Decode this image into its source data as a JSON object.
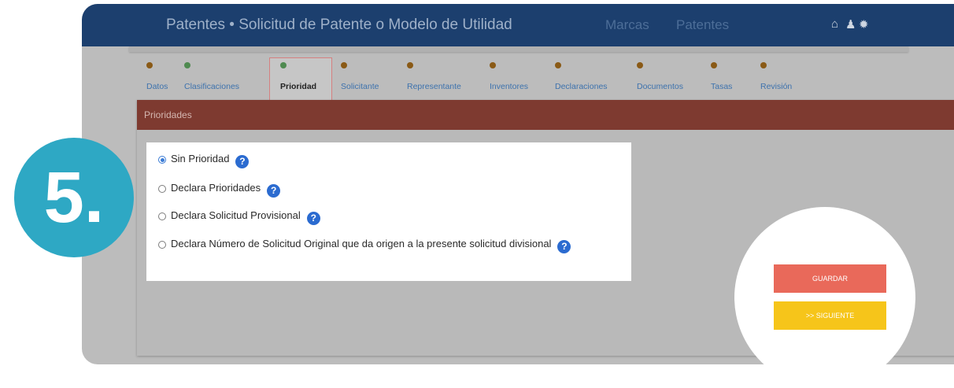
{
  "header": {
    "title": "Patentes • Solicitud de Patente o Modelo de Utilidad",
    "nav": [
      "Marcas",
      "Patentes"
    ],
    "icons": [
      "home-icon",
      "user-icon",
      "settings-icon"
    ]
  },
  "steps": [
    {
      "label": "Datos",
      "status": "warning"
    },
    {
      "label": "Clasificaciones",
      "status": "done"
    },
    {
      "label": "Prioridad",
      "status": "done",
      "active": true
    },
    {
      "label": "Solicitante",
      "status": "warning"
    },
    {
      "label": "Representante",
      "status": "warning"
    },
    {
      "label": "Inventores",
      "status": "warning"
    },
    {
      "label": "Declaraciones",
      "status": "warning"
    },
    {
      "label": "Documentos",
      "status": "warning"
    },
    {
      "label": "Tasas",
      "status": "warning"
    },
    {
      "label": "Revisión",
      "status": "warning"
    }
  ],
  "card": {
    "title": "Prioridades"
  },
  "priority_options": [
    {
      "label": "Sin Prioridad",
      "selected": true
    },
    {
      "label": "Declara Prioridades",
      "selected": false
    },
    {
      "label": "Declara Solicitud Provisional",
      "selected": false
    },
    {
      "label": "Declara Número de Solicitud Original que da origen a la presente solicitud divisional",
      "selected": false
    }
  ],
  "buttons": {
    "save": "GUARDAR",
    "next": ">> SIGUIENTE"
  },
  "annotation": {
    "number": "5."
  },
  "colors": {
    "header_bg": "#1c3f6e",
    "card_header": "#7e3a30",
    "save_button": "#e9695a",
    "next_button": "#f6c51a",
    "badge": "#2ea8c4",
    "radio_accent": "#3a7bd5"
  }
}
